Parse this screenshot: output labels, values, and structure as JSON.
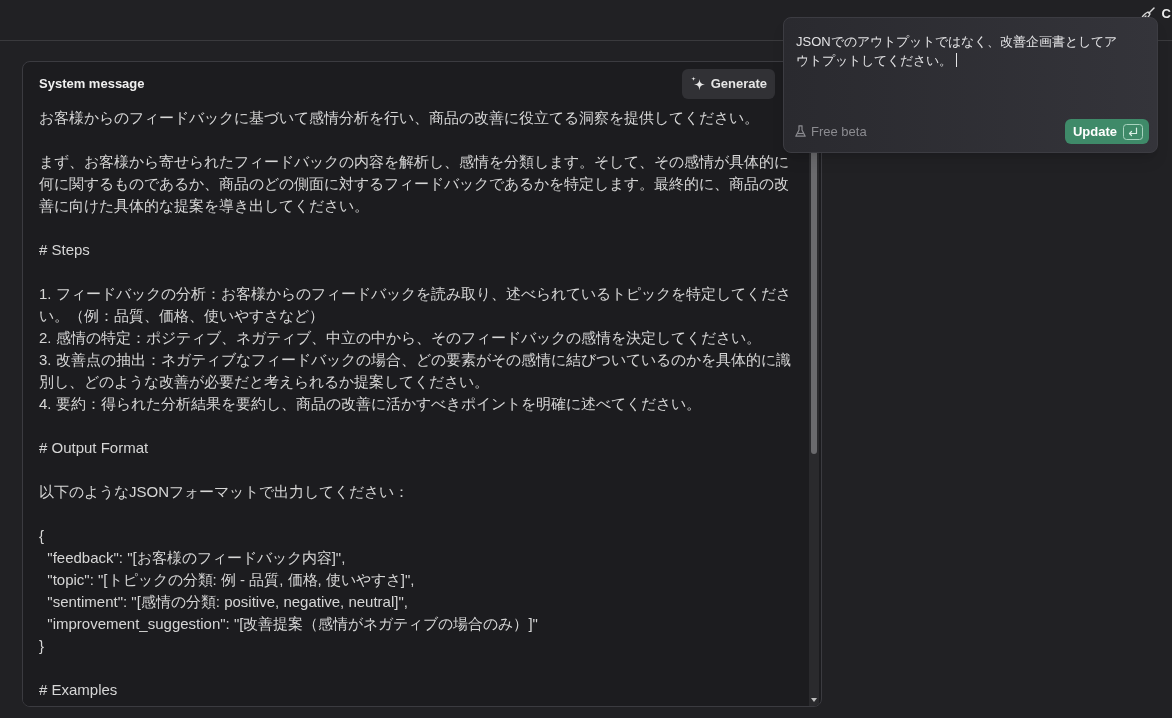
{
  "top_bar": {
    "button_label": "C"
  },
  "system_message": {
    "title": "System message",
    "generate_button": "Generate",
    "blocks": [
      [
        "お客様からのフィードバックに基づいて感情分析を行い、商品の改善に役立てる洞察を提供してください。"
      ],
      [
        "まず、お客様から寄せられたフィードバックの内容を解析し、感情を分類します。そして、その感情が具体的に何に関するものであるか、商品のどの側面に対するフィードバックであるかを特定します。最終的に、商品の改善に向けた具体的な提案を導き出してください。"
      ],
      [
        "# Steps"
      ],
      [
        "1. フィードバックの分析：お客様からのフィードバックを読み取り、述べられているトピックを特定してください。（例：品質、価格、使いやすさなど）",
        "2. 感情の特定：ポジティブ、ネガティブ、中立の中から、そのフィードバックの感情を決定してください。",
        "3. 改善点の抽出：ネガティブなフィードバックの場合、どの要素がその感情に結びついているのかを具体的に識別し、どのような改善が必要だと考えられるか提案してください。",
        "4. 要約：得られた分析結果を要約し、商品の改善に活かすべきポイントを明確に述べてください。"
      ],
      [
        "# Output Format"
      ],
      [
        "以下のようなJSONフォーマットで出力してください："
      ],
      [
        "{",
        "  \"feedback\": \"[お客様のフィードバック内容]\",",
        "  \"topic\": \"[トピックの分類: 例 - 品質, 価格, 使いやすさ]\",",
        "  \"sentiment\": \"[感情の分類: positive, negative, neutral]\",",
        "  \"improvement_suggestion\": \"[改善提案（感情がネガティブの場合のみ）]\"",
        "}"
      ],
      [
        "# Examples"
      ]
    ]
  },
  "edit_popup": {
    "value": "JSONでのアウトプットではなく、改善企画書としてアウトプットしてください。",
    "note": "Free beta",
    "submit_button": "Update"
  }
}
